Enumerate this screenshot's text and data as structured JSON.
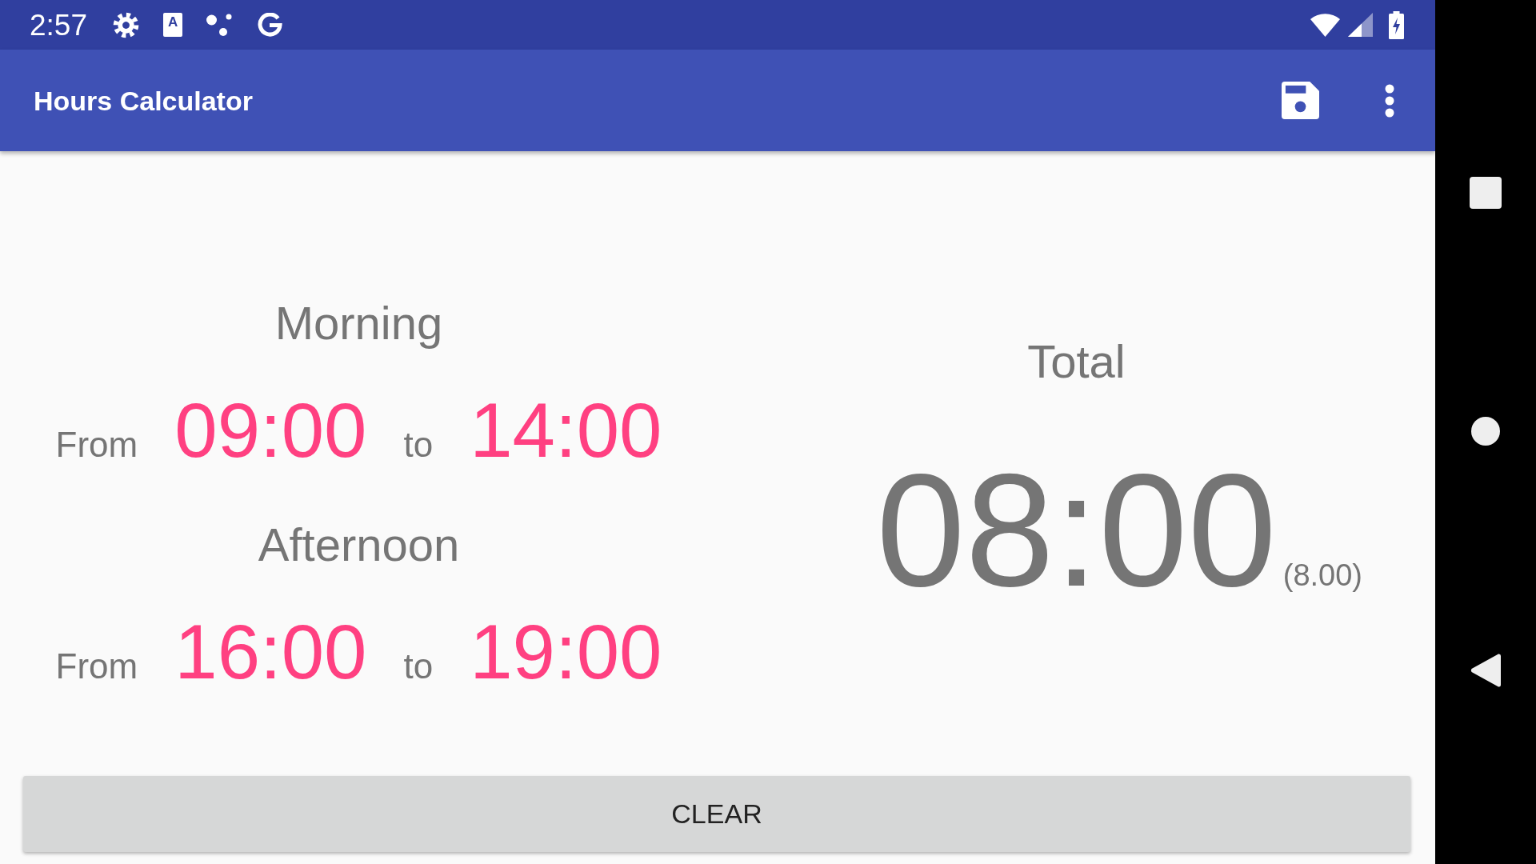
{
  "status_bar": {
    "time": "2:57",
    "notification_letter": "A"
  },
  "app_bar": {
    "title": "Hours Calculator"
  },
  "periods": [
    {
      "label": "Morning",
      "from_label": "From",
      "from": "09:00",
      "to_label": "to",
      "to": "14:00"
    },
    {
      "label": "Afternoon",
      "from_label": "From",
      "from": "16:00",
      "to_label": "to",
      "to": "19:00"
    }
  ],
  "total": {
    "label": "Total",
    "value": "08:00",
    "decimal_value": "(8.00)"
  },
  "clear_button": {
    "label": "CLEAR"
  }
}
